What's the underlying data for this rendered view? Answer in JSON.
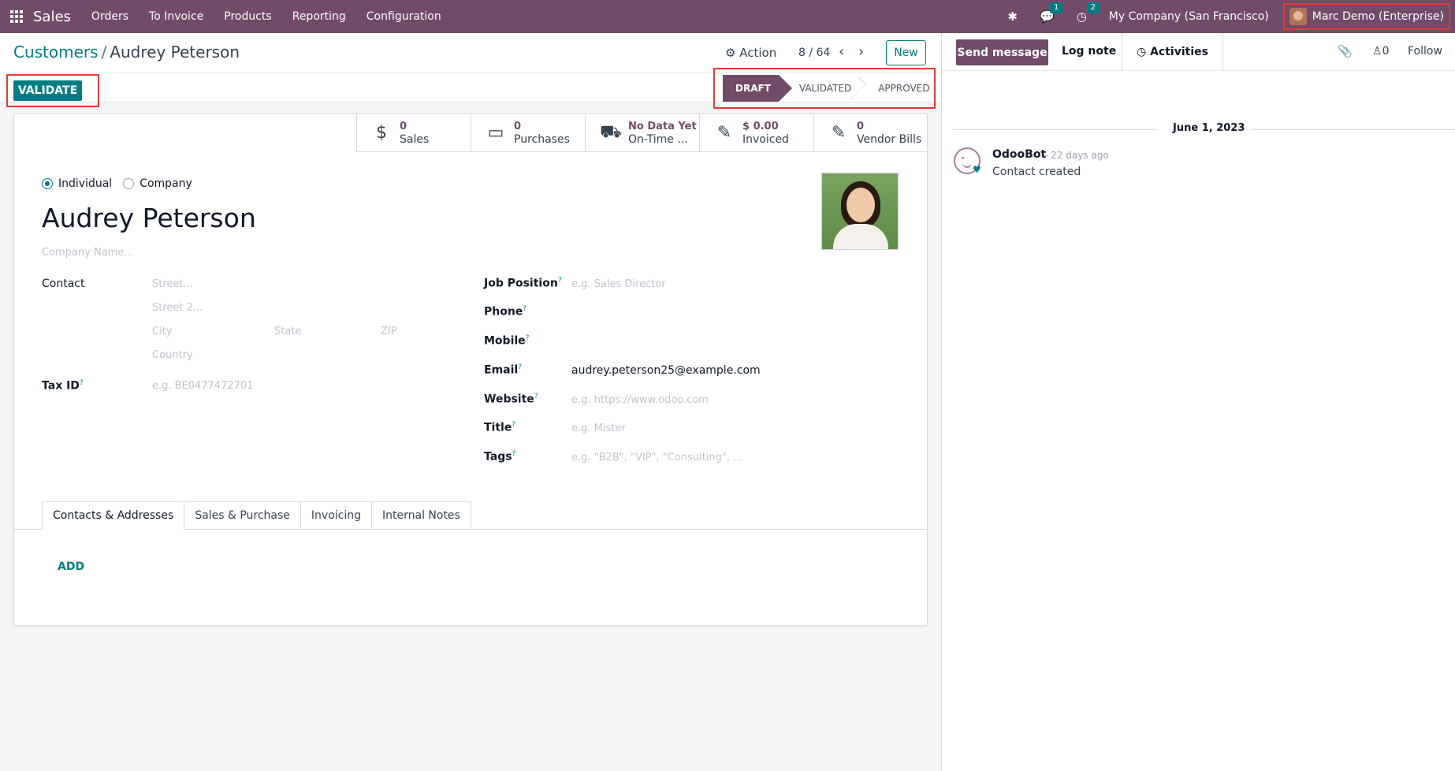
{
  "navbar": {
    "app_name": "Sales",
    "menu": [
      "Orders",
      "To Invoice",
      "Products",
      "Reporting",
      "Configuration"
    ],
    "messages_count": "1",
    "activities_count": "2",
    "company": "My Company (San Francisco)",
    "user": "Marc Demo (Enterprise)"
  },
  "breadcrumb": {
    "parent": "Customers",
    "separator": "/",
    "current": "Audrey Peterson"
  },
  "control": {
    "action_label": "Action",
    "pager": "8 / 64",
    "new_label": "New"
  },
  "statusbar": {
    "validate_label": "VALIDATE",
    "stages": [
      "DRAFT",
      "VALIDATED",
      "APPROVED"
    ],
    "active_stage": "DRAFT"
  },
  "stat_buttons": [
    {
      "icon": "dollar-icon",
      "value": "0",
      "label": "Sales"
    },
    {
      "icon": "credit-card-icon",
      "value": "0",
      "label": "Purchases"
    },
    {
      "icon": "truck-icon",
      "value": "No Data Yet",
      "label": "On-Time ..."
    },
    {
      "icon": "edit-icon",
      "value": "$ 0.00",
      "label": "Invoiced"
    },
    {
      "icon": "edit-icon",
      "value": "0",
      "label": "Vendor Bills"
    }
  ],
  "form": {
    "type_individual": "Individual",
    "type_company": "Company",
    "name": "Audrey Peterson",
    "company_name_placeholder": "Company Name...",
    "contact_label": "Contact",
    "street_placeholder": "Street...",
    "street2_placeholder": "Street 2...",
    "city_placeholder": "City",
    "state_placeholder": "State",
    "zip_placeholder": "ZIP",
    "country_placeholder": "Country",
    "tax_id_label": "Tax ID",
    "tax_id_placeholder": "e.g. BE0477472701",
    "job_position_label": "Job Position",
    "job_position_placeholder": "e.g. Sales Director",
    "phone_label": "Phone",
    "mobile_label": "Mobile",
    "email_label": "Email",
    "email_value": "audrey.peterson25@example.com",
    "website_label": "Website",
    "website_placeholder": "e.g. https://www.odoo.com",
    "title_label": "Title",
    "title_placeholder": "e.g. Mister",
    "tags_label": "Tags",
    "tags_placeholder": "e.g. \"B2B\", \"VIP\", \"Consulting\", ...",
    "help_mark": "?"
  },
  "tabs": [
    "Contacts & Addresses",
    "Sales & Purchase",
    "Invoicing",
    "Internal Notes"
  ],
  "add_label": "ADD",
  "chatter": {
    "send_message": "Send message",
    "log_note": "Log note",
    "activities": "Activities",
    "followers_count": "0",
    "follow": "Follow",
    "date": "June 1, 2023",
    "author": "OdooBot",
    "time": "- 22 days ago",
    "body": "Contact created"
  },
  "colors": {
    "brand": "#714b67",
    "accent": "#017e84",
    "highlight": "#e53935"
  }
}
